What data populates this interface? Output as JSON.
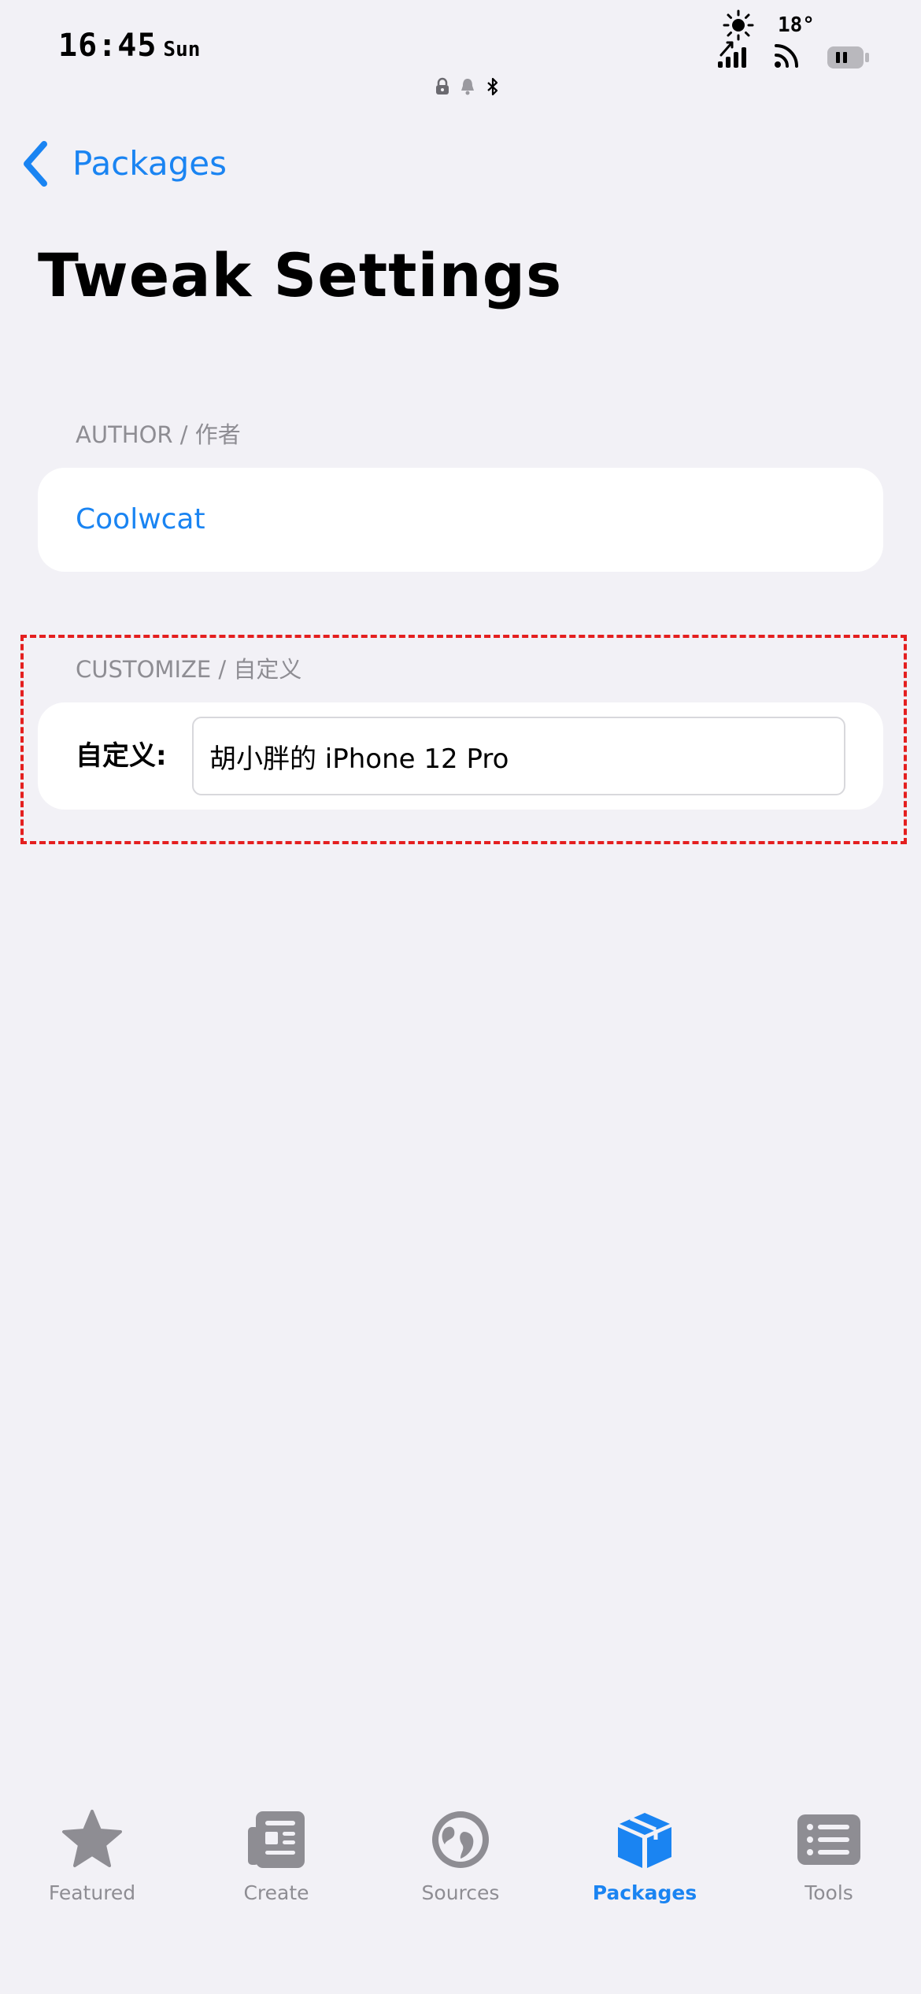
{
  "status_bar": {
    "time": "16:45",
    "day": "Sun",
    "temperature": "18°",
    "icons": [
      "sun-icon",
      "signal-icon",
      "wifi-icon",
      "battery-icon",
      "lock-icon",
      "bell-icon",
      "bluetooth-icon"
    ]
  },
  "nav": {
    "back_label": "Packages",
    "title": "Tweak Settings"
  },
  "sections": {
    "author": {
      "header": "AUTHOR / 作者",
      "value": "Coolwcat"
    },
    "customize": {
      "header": "CUSTOMIZE / 自定义",
      "field_label": "自定义:",
      "field_value": "胡小胖的 iPhone 12 Pro"
    }
  },
  "tab_bar": {
    "active": "Packages",
    "tabs": [
      {
        "label": "Featured",
        "icon": "star-icon"
      },
      {
        "label": "Create",
        "icon": "newspaper-icon"
      },
      {
        "label": "Sources",
        "icon": "globe-icon"
      },
      {
        "label": "Packages",
        "icon": "box-icon"
      },
      {
        "label": "Tools",
        "icon": "list-icon"
      }
    ]
  },
  "colors": {
    "accent": "#1a84f2",
    "background": "#f2f1f6",
    "secondary_text": "#8e8d93",
    "highlight": "#e41f1f"
  }
}
